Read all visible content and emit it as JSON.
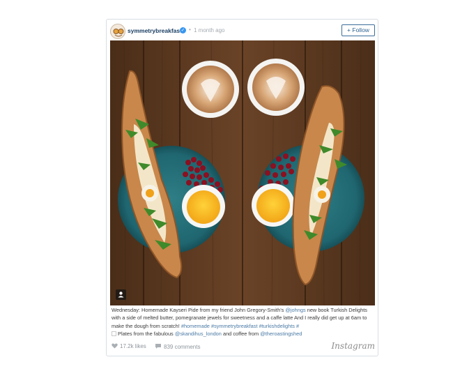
{
  "post": {
    "username": "symmetrybreakfast",
    "separator": "•",
    "timestamp": "1 month ago",
    "follow_label": "+ Follow",
    "caption": {
      "t1": "Wednesday: Homemade Kayseri Pide from my friend John Gregory-Smith's ",
      "m1": "@johngs",
      "t2": " new book Turkish Delights with a side of melted butter, pomegranate jewels for sweetness and a caffe latte And I really did get up at 6am to make the dough from scratch! ",
      "h1": "#homemade",
      "sp1": " ",
      "h2": "#symmetrybreakfast",
      "sp2": " ",
      "h3": "#turkishdelights",
      "sp3": " ",
      "h4": "#",
      "t3": " Plates from the fabulous ",
      "m2": "@skandihus_london",
      "t4": " and coffee from ",
      "m3": "@theroastingshed"
    },
    "likes": "17.2k likes",
    "comments": "839 comments",
    "brand": "Instagram"
  },
  "icons": {
    "verified": "verified-badge-icon",
    "user_tag": "user-tag-icon",
    "heart": "heart-icon",
    "comment": "comment-bubble-icon"
  },
  "colors": {
    "link": "#4a7aa5",
    "username": "#1a3e63",
    "verified": "#3897f0",
    "muted": "#a4aab1"
  }
}
